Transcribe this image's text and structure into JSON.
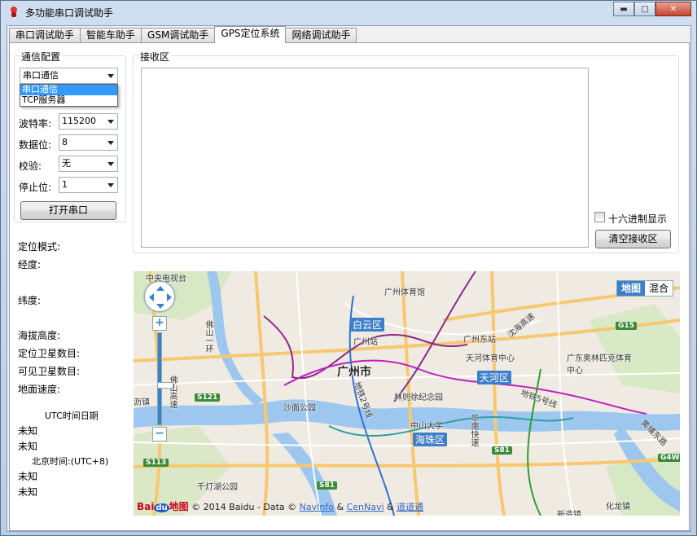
{
  "window": {
    "title": "多功能串口调试助手"
  },
  "tabs": [
    "串口调试助手",
    "智能车助手",
    "GSM调试助手",
    "GPS定位系统",
    "网络调试助手"
  ],
  "config": {
    "group_label": "通信配置",
    "mode_value": "串口通信",
    "mode_options": [
      "串口通信",
      "TCP服务器"
    ],
    "baud_label": "波特率:",
    "baud_value": "115200",
    "databits_label": "数据位:",
    "databits_value": "8",
    "parity_label": "校验:",
    "parity_value": "无",
    "stopbits_label": "停止位:",
    "stopbits_value": "1",
    "open_button": "打开串口"
  },
  "receive": {
    "group_label": "接收区",
    "hex_label": "十六进制显示",
    "clear_button": "清空接收区"
  },
  "gps": {
    "mode_label": "定位模式:",
    "lon_label": "经度:",
    "lat_label": "纬度:",
    "alt_label": "海拔高度:",
    "used_sats_label": "定位卫星数目:",
    "visible_sats_label": "可见卫星数目:",
    "speed_label": "地面速度:",
    "utc_label": "UTC时间日期",
    "utc_date": "未知",
    "utc_time": "未知",
    "bj_label": "北京时间:(UTC+8)",
    "bj_date": "未知",
    "bj_time": "未知"
  },
  "map": {
    "type_map": "地图",
    "type_hybrid": "混合",
    "city": "广州市",
    "districts": [
      "白云区",
      "天河区",
      "海珠区"
    ],
    "places": [
      "中央电视台",
      "广州体育馆",
      "广州站",
      "广州东站",
      "天河体育中心",
      "广东奥林匹克体育中心",
      "林则徐纪念园",
      "中山大学",
      "沙面公园",
      "千灯湖公园",
      "新造镇",
      "化龙镇",
      "沥镇",
      "佛山一环",
      "佛山高速",
      "沈海高速",
      "黄埔东路",
      "地铁5号线",
      "地铁2号线",
      "华南快速"
    ],
    "roads": [
      "G15",
      "S121",
      "S113",
      "S81",
      "S81",
      "G4W"
    ],
    "logo": "Bai地图",
    "copyright_text": "© 2014 Baidu - Data ©",
    "link1": "NavInfo",
    "amp": "&",
    "link2": "CenNavi",
    "link3": "道道通"
  }
}
